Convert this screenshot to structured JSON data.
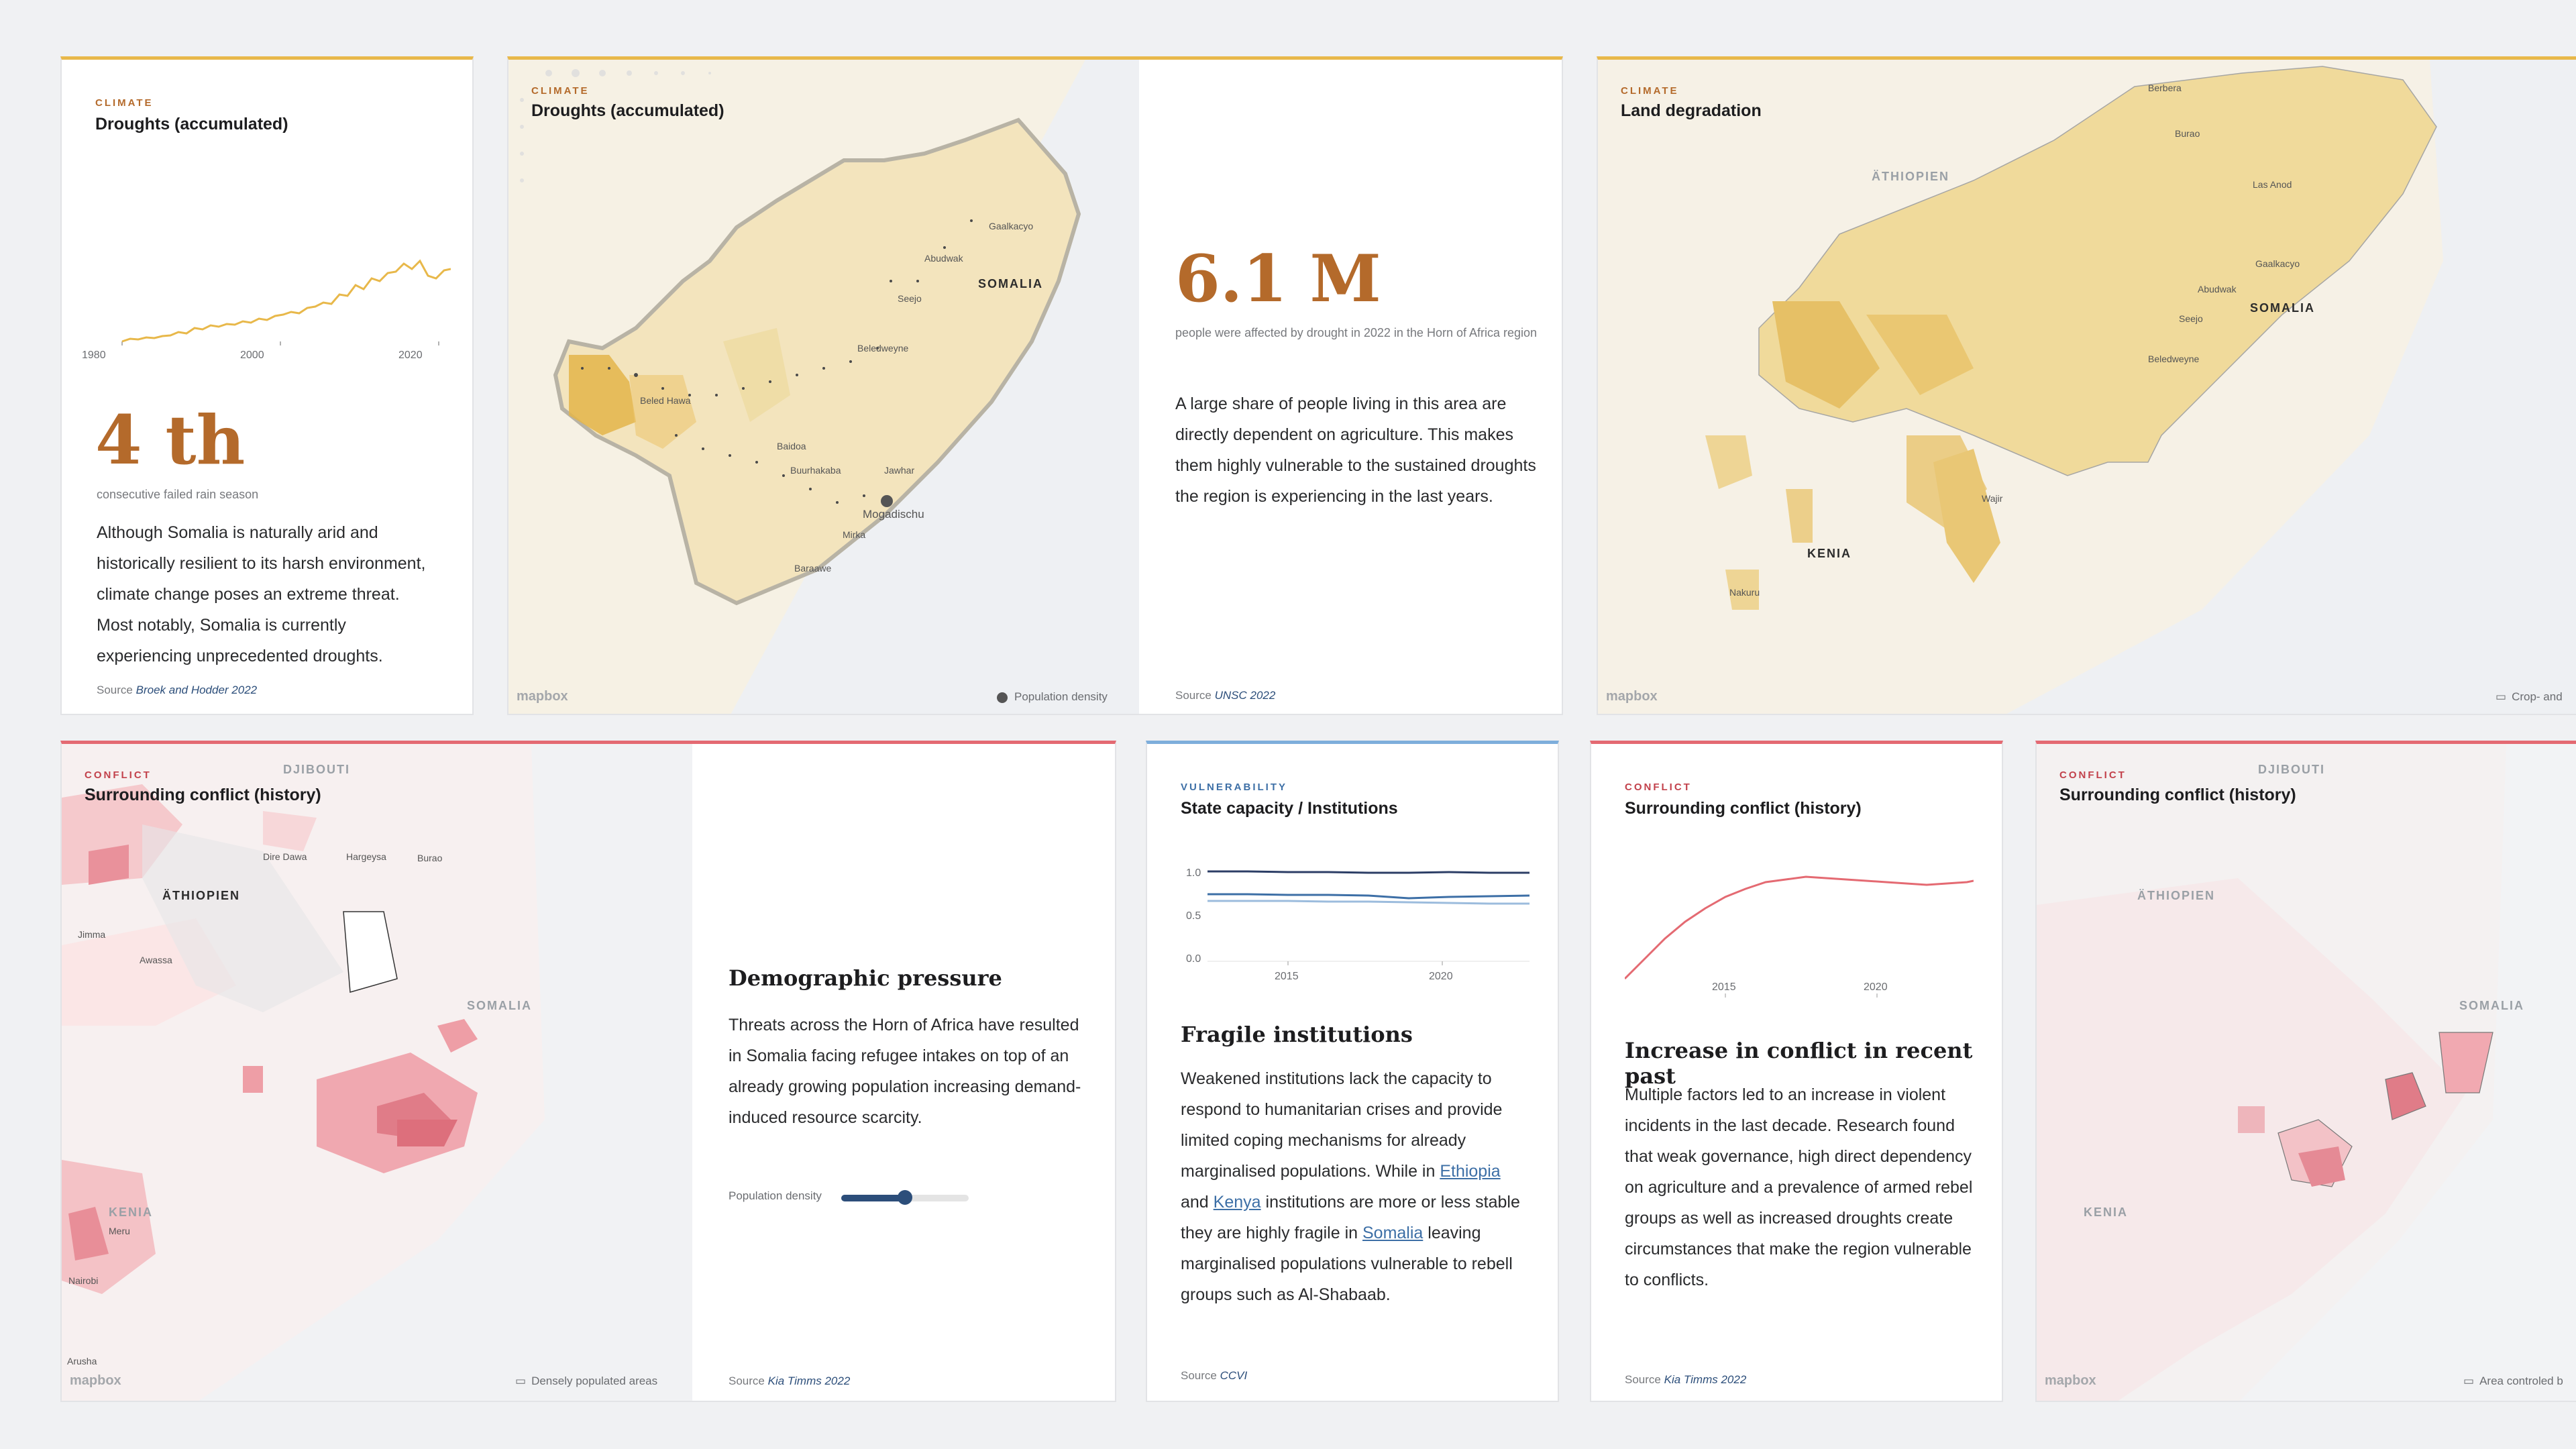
{
  "card1": {
    "kicker": "CLIMATE",
    "title": "Droughts (accumulated)",
    "x_ticks": [
      "1980",
      "2000",
      "2020"
    ],
    "big_value": "4 th",
    "big_caption": "consecutive failed rain season",
    "body": "Although Somalia is naturally arid and historically resilient to its harsh environment, climate change poses an extreme threat. Most notably, Somalia is currently experiencing unprecedented droughts.",
    "source_prefix": "Source",
    "source": "Broek and Hodder 2022",
    "line_color": "#e8b84a"
  },
  "card2": {
    "kicker": "CLIMATE",
    "title": "Droughts (accumulated)",
    "map_labels": [
      "Gaalkacyo",
      "Abudwak",
      "SOMALIA",
      "Seejo",
      "Beledweyne",
      "Beled Hawa",
      "Baidoa",
      "Buurhakaba",
      "Jawhar",
      "Mogadischu",
      "Mirka",
      "Baraawe"
    ],
    "mapbox": "mapbox",
    "legend": "Population density",
    "big_value": "6.1 M",
    "big_caption": "people were affected by drought in 2022 in the Horn of Africa region",
    "body": "A large share of people living in this area are directly dependent on agriculture. This makes them highly vulnerable to the sustained droughts the region is experiencing in the last years.",
    "source_prefix": "Source",
    "source": "UNSC 2022"
  },
  "card3": {
    "kicker": "CLIMATE",
    "title": "Land degradation",
    "map_labels": [
      "Berbera",
      "Burao",
      "Las Anod",
      "ÄTHIOPIEN",
      "Gaalkacyo",
      "Abudwak",
      "SOMALIA",
      "Seejo",
      "Beledweyne",
      "Wajir",
      "KENIA",
      "Nakuru"
    ],
    "mapbox": "mapbox",
    "legend": "Crop- and"
  },
  "card4": {
    "kicker": "CONFLICT",
    "title": "Surrounding conflict (history)",
    "map_labels": [
      "DJIBOUTI",
      "Dire Dawa",
      "Hargeysa",
      "Burao",
      "ÄTHIOPIEN",
      "Jimma",
      "Awassa",
      "SOMALIA",
      "KENIA",
      "Meru",
      "Nairobi",
      "Arusha"
    ],
    "mapbox": "mapbox",
    "legend": "Densely populated areas",
    "heading": "Demographic pressure",
    "body": "Threats across the Horn of Africa have resulted in Somalia facing refugee intakes on top of an already growing population increasing demand-induced resource scarcity.",
    "slider_label": "Population density",
    "slider_value": 0.5,
    "source_prefix": "Source",
    "source": "Kia Timms 2022"
  },
  "card5": {
    "kicker": "VULNERABILITY",
    "title": "State capacity / Institutions",
    "y_ticks": [
      "1.0",
      "0.5",
      "0.0"
    ],
    "x_ticks": [
      "2015",
      "2020"
    ],
    "heading": "Fragile institutions",
    "body_1": "Weakened institutions lack the capacity to respond to humanitarian crises and provide limited coping mechanisms for already marginalised populations. While in ",
    "link_1": "Ethiopia",
    "body_2": " and ",
    "link_2": "Kenya",
    "body_3": " institutions are more or less stable they are highly fragile in ",
    "link_3": "Somalia",
    "body_4": " leaving marginalised populations vulnerable to rebell groups such as Al-Shabaab.",
    "source_prefix": "Source",
    "source": "CCVI"
  },
  "card6": {
    "kicker": "CONFLICT",
    "title": "Surrounding conflict (history)",
    "x_ticks": [
      "2015",
      "2020"
    ],
    "heading": "Increase in conflict in recent past",
    "body": "Multiple factors led to an increase in violent incidents in the last decade. Research found that weak governance, high direct dependency on agriculture and a prevalence of armed rebel groups as well as increased droughts create circumstances that make the region vulnerable to conflicts.",
    "source_prefix": "Source",
    "source": "Kia Timms 2022",
    "line_color": "#e46a72"
  },
  "card7": {
    "kicker": "CONFLICT",
    "title": "Surrounding conflict (history)",
    "map_labels": [
      "DJIBOUTI",
      "ÄTHIOPIEN",
      "SOMALIA",
      "KENIA"
    ],
    "mapbox": "mapbox",
    "legend": "Area controled b"
  }
}
